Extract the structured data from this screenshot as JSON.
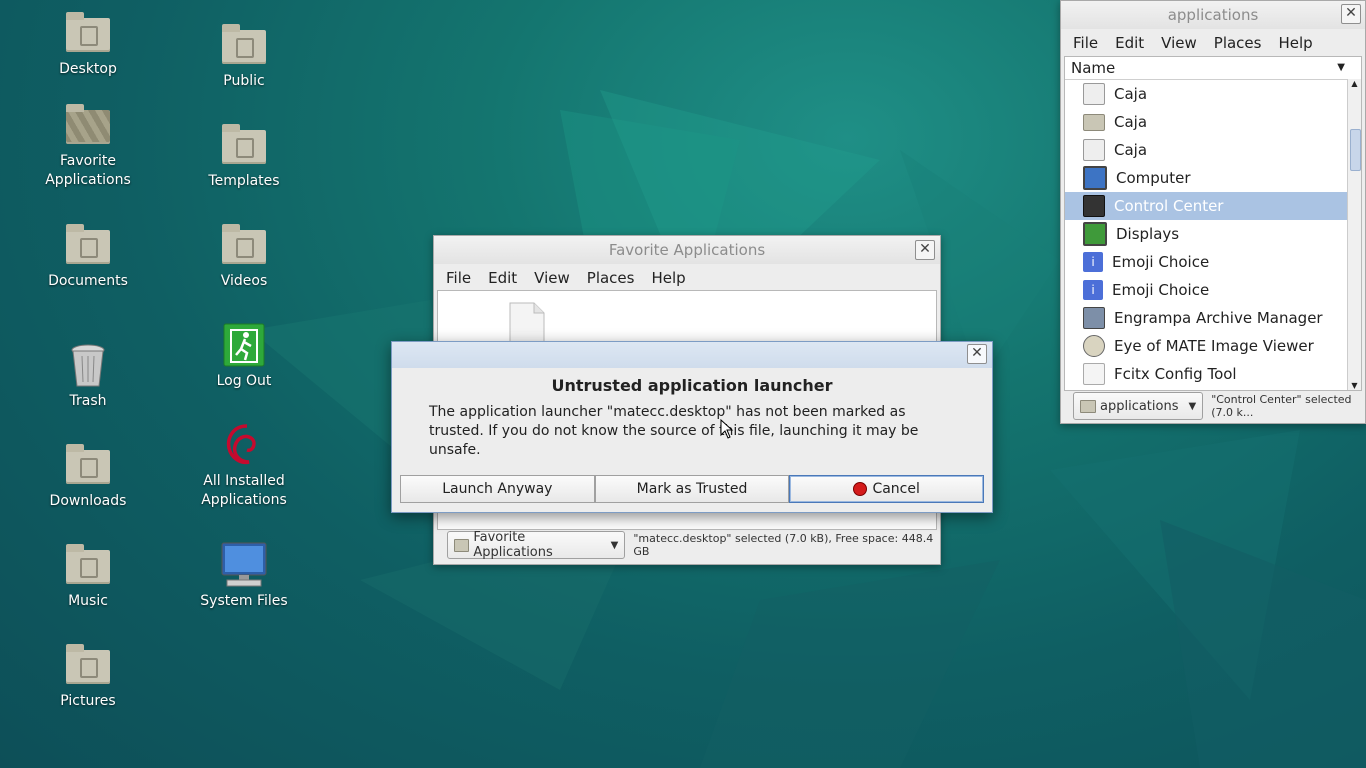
{
  "desktop": {
    "icons": [
      {
        "label": "Desktop"
      },
      {
        "label": "Favorite\nApplications"
      },
      {
        "label": "Documents"
      },
      {
        "label": "Trash"
      },
      {
        "label": "Downloads"
      },
      {
        "label": "Music"
      },
      {
        "label": "Pictures"
      },
      {
        "label": "Public"
      },
      {
        "label": "Templates"
      },
      {
        "label": "Videos"
      },
      {
        "label": "Log Out"
      },
      {
        "label": "All Installed\nApplications"
      },
      {
        "label": "System Files"
      }
    ]
  },
  "fav_window": {
    "title": "Favorite Applications",
    "menu": [
      "File",
      "Edit",
      "View",
      "Places",
      "Help"
    ],
    "location": "Favorite Applications",
    "status": "\"matecc.desktop\" selected (7.0 kB), Free space: 448.4 GB"
  },
  "apps_window": {
    "title": "applications",
    "menu": [
      "File",
      "Edit",
      "View",
      "Places",
      "Help"
    ],
    "column": "Name",
    "rows": [
      {
        "label": "Caja",
        "icon": "text-file-icon"
      },
      {
        "label": "Caja",
        "icon": "folder-icon"
      },
      {
        "label": "Caja",
        "icon": "text-file-icon"
      },
      {
        "label": "Computer",
        "icon": "computer-icon"
      },
      {
        "label": "Control Center",
        "icon": "control-center-icon"
      },
      {
        "label": "Displays",
        "icon": "display-icon"
      },
      {
        "label": "Emoji Choice",
        "icon": "info-icon"
      },
      {
        "label": "Emoji Choice",
        "icon": "info-icon"
      },
      {
        "label": "Engrampa Archive Manager",
        "icon": "archive-icon"
      },
      {
        "label": "Eye of MATE Image Viewer",
        "icon": "image-viewer-icon"
      },
      {
        "label": "Fcitx Config Tool",
        "icon": "text-file-icon"
      }
    ],
    "selected_index": 4,
    "location": "applications",
    "status": "\"Control Center\" selected (7.0 k..."
  },
  "dialog": {
    "title": "Untrusted application launcher",
    "message": "The application launcher \"matecc.desktop\" has not been marked as trusted. If you do not know the source of this file, launching it may be unsafe.",
    "buttons": {
      "launch": "Launch Anyway",
      "trust": "Mark as Trusted",
      "cancel": "Cancel"
    }
  },
  "colors": {
    "selection": "#aac3e3",
    "cancel_dot": "#d41b1b"
  }
}
